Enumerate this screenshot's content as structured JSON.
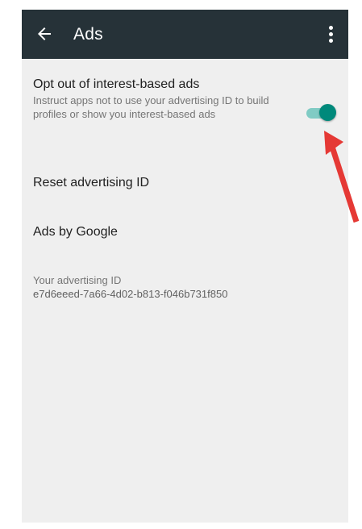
{
  "app_bar": {
    "title": "Ads",
    "back_icon": "arrow-left",
    "menu_icon": "more-vertical"
  },
  "opt_out": {
    "title": "Opt out of interest-based ads",
    "summary": "Instruct apps not to use your advertising ID to build profiles or show you interest-based ads",
    "toggle_on": true
  },
  "reset_id": {
    "title": "Reset advertising ID"
  },
  "ads_by_google": {
    "title": "Ads by Google"
  },
  "advertising_id": {
    "label": "Your advertising ID",
    "value": "e7d6eeed-7a66-4d02-b813-f046b731f850"
  },
  "colors": {
    "app_bar": "#263238",
    "accent": "#00897b",
    "annotation_arrow": "#e53935"
  }
}
